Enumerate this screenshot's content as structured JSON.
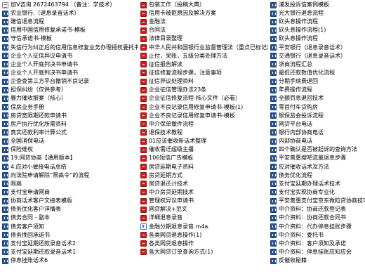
{
  "file_list": {
    "columns": [
      [
        {
          "name": "加V咨询 2672463794 （备注：学技术）",
          "type": "txt"
        },
        {
          "name": "农业银行.（退息录音话术）",
          "type": "doc"
        },
        {
          "name": "建信退息流程",
          "type": "doc"
        },
        {
          "name": "信用中国信用修复承诺书-模板",
          "type": "doc"
        },
        {
          "name": "守信承诺书-模板",
          "type": "doc"
        },
        {
          "name": "失信行为纠正后的信用信息修复业务办理授权委托书",
          "type": "doc"
        },
        {
          "name": "企业个人征信异议申请书",
          "type": "doc"
        },
        {
          "name": "企业个人开庭判决书申请书",
          "type": "doc"
        },
        {
          "name": "企业个人开庭判决书申请书",
          "type": "doc"
        },
        {
          "name": "企查查第三方平台撤销不良记录",
          "type": "doc"
        },
        {
          "name": "担保纠纷（仅供参考）",
          "type": "doc"
        },
        {
          "name": "暴力催收报案（核心）",
          "type": "doc"
        },
        {
          "name": "保房业务手册",
          "type": "doc"
        },
        {
          "name": "房贷宽限期还款申请书",
          "type": "doc"
        },
        {
          "name": "房产执行优化所需资料",
          "type": "doc"
        },
        {
          "name": "真实还款利率计算公式",
          "type": "doc"
        },
        {
          "name": "全国消保电话",
          "type": "doc"
        },
        {
          "name": "保险维权",
          "type": "doc"
        },
        {
          "name": "19.网贷协商【通用版本】",
          "type": "doc"
        },
        {
          "name": "4.应对小催接电话总结",
          "type": "doc"
        },
        {
          "name": "向法院申请解除“限高令”的流程",
          "type": "doc"
        },
        {
          "name": "限高",
          "type": "doc"
        },
        {
          "name": "支付宝申请网商",
          "type": "doc"
        },
        {
          "name": "协商话术客户文接表模版",
          "type": "doc"
        },
        {
          "name": "债务优化客户洋情表",
          "type": "doc"
        },
        {
          "name": "债务合同 - 副本",
          "type": "doc"
        },
        {
          "name": "债务客户须知",
          "type": "doc"
        },
        {
          "name": "债务挽回承诺书",
          "type": "doc"
        },
        {
          "name": "支付宝延期还款录音话术2",
          "type": "doc"
        },
        {
          "name": "支付宝延期还款录音话术1",
          "type": "doc"
        },
        {
          "name": "停息挂账话术6",
          "type": "doc"
        }
      ],
      [
        {
          "name": "包装工作（投稿大典）",
          "type": "pdf"
        },
        {
          "name": "信用卡被拒原因及解决方案",
          "type": "pdf"
        },
        {
          "name": "金融法",
          "type": "pdf"
        },
        {
          "name": "合同法",
          "type": "pdf"
        },
        {
          "name": "法律目录整理",
          "type": "pdf"
        },
        {
          "name": "中华人民共和国银行业监督管理法（重点已标记）",
          "type": "pdf"
        },
        {
          "name": "止付，呆账，五级分类处理方法",
          "type": "pdf"
        },
        {
          "name": "征信报告解读",
          "type": "pdf"
        },
        {
          "name": "征信修复流程步骤，注意事项",
          "type": "pdf"
        },
        {
          "name": "征信异议处理资料",
          "type": "pdf"
        },
        {
          "name": "企业征信管理办法23条",
          "type": "pdf"
        },
        {
          "name": "企业征信修复流程-核心文件（必看）",
          "type": "pdf"
        },
        {
          "name": "企业不良记录信用修复申请书-模板(1)",
          "type": "pdf"
        },
        {
          "name": "企业不良记录信用修复申请书-模板",
          "type": "pdf"
        },
        {
          "name": "中介保单撤件流程",
          "type": "pdf"
        },
        {
          "name": "退保技术教程",
          "type": "pdf"
        },
        {
          "name": "01应该催收新话术整理",
          "type": "pdf"
        },
        {
          "name": "催收需迁超级主播",
          "type": "pdf"
        },
        {
          "name": "106短信广告模板",
          "type": "pdf"
        },
        {
          "name": "房贷延期电子资料",
          "type": "pdf"
        },
        {
          "name": "房贷延期方式",
          "type": "pdf"
        },
        {
          "name": "房贷退还计技术",
          "type": "pdf"
        },
        {
          "name": "中介房贷延期技术",
          "type": "pdf"
        },
        {
          "name": "管理权异议申请书",
          "type": "pdf"
        },
        {
          "name": "网贷解决+范文",
          "type": "pdf"
        },
        {
          "name": "洋细退息录音",
          "type": "pdf"
        },
        {
          "name": "金融分期退息录音.m4a.",
          "type": "audio"
        },
        {
          "name": "各类网贷退息操作(1)",
          "type": "pdf"
        },
        {
          "name": "各类网贷退息操作",
          "type": "pdf"
        },
        {
          "name": "各大网贷订单查询方式(1)",
          "type": "pdf"
        }
      ],
      [
        {
          "name": "浦发投诉信案例模板",
          "type": "doc"
        },
        {
          "name": "光大银行退息流程",
          "type": "doc"
        },
        {
          "name": "砍头息操作流程",
          "type": "doc"
        },
        {
          "name": "砍头息操作流程(1)",
          "type": "doc"
        },
        {
          "name": "砍头息操作流程",
          "type": "doc"
        },
        {
          "name": "平安银行（退息录音话术）",
          "type": "doc"
        },
        {
          "name": "交通银行（退息录音话术）",
          "type": "doc"
        },
        {
          "name": "浙商流程汇总",
          "type": "doc"
        },
        {
          "name": "最低还款数值优化流程",
          "type": "doc"
        },
        {
          "name": "分期手续费退回",
          "type": "doc"
        },
        {
          "name": "年费操作流程",
          "type": "doc"
        },
        {
          "name": "全额罚息退回技术",
          "type": "doc"
        },
        {
          "name": "零首付车贷购房",
          "type": "doc"
        },
        {
          "name": "银保监会投诉流程",
          "type": "doc"
        },
        {
          "name": "网贷平台电话",
          "type": "doc"
        },
        {
          "name": "银行内部协商电话",
          "type": "doc"
        },
        {
          "name": "内部协商电话",
          "type": "doc"
        },
        {
          "name": "四个确认是否被起诉的查询方法",
          "type": "doc"
        },
        {
          "name": "平安普惠搜吧流量退息步骤",
          "type": "doc"
        },
        {
          "name": "应对催收话术及方法",
          "type": "doc"
        },
        {
          "name": "债务优化流程",
          "type": "doc"
        },
        {
          "name": "支付宝延期办理话术技术",
          "type": "doc"
        },
        {
          "name": "支付宝实现协商专业化",
          "type": "doc"
        },
        {
          "name": "平安普惠支付宝京东微粒贷协商技巧",
          "type": "doc"
        },
        {
          "name": "中介资料：协商还款登记表",
          "type": "doc"
        },
        {
          "name": "中介资料：协商还款合同书",
          "type": "doc"
        },
        {
          "name": "中介资料：代办停息挂账步骤",
          "type": "doc"
        },
        {
          "name": "中介资料：委托书",
          "type": "doc"
        },
        {
          "name": "中介资料：客户须知及承诺",
          "type": "doc"
        },
        {
          "name": "中介资料：停息挂账应知应会",
          "type": "doc"
        },
        {
          "name": "反催收秘籍",
          "type": "doc"
        }
      ]
    ]
  }
}
